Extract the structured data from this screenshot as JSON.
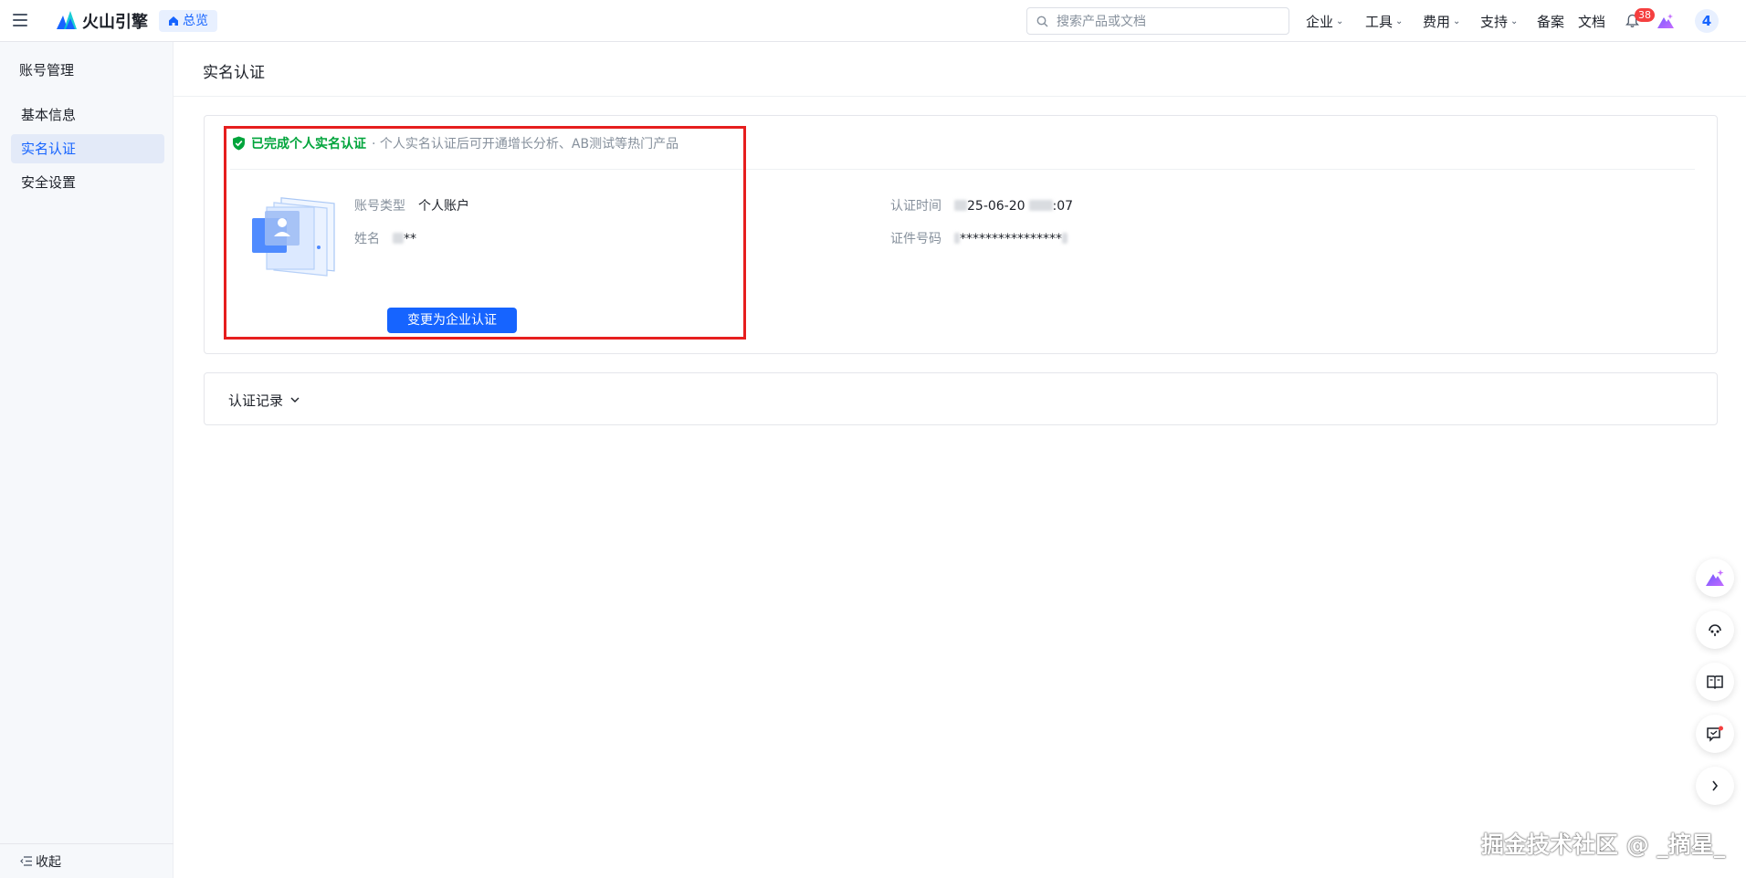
{
  "header": {
    "brand_name": "火山引擎",
    "home_chip": "总览",
    "search_placeholder": "搜索产品或文档",
    "nav": [
      {
        "label": "企业",
        "dropdown": true
      },
      {
        "label": "工具",
        "dropdown": true
      },
      {
        "label": "费用",
        "dropdown": true
      },
      {
        "label": "支持",
        "dropdown": true
      },
      {
        "label": "备案",
        "dropdown": false
      },
      {
        "label": "文档",
        "dropdown": false
      }
    ],
    "notification_count": "38",
    "avatar_text": "4"
  },
  "sidebar": {
    "title": "账号管理",
    "items": [
      {
        "label": "基本信息",
        "active": false
      },
      {
        "label": "实名认证",
        "active": true
      },
      {
        "label": "安全设置",
        "active": false
      }
    ],
    "collapse_label": "收起"
  },
  "main": {
    "page_title": "实名认证",
    "status": {
      "main": "已完成个人实名认证",
      "sub": "· 个人实名认证后可开通增长分析、AB测试等热门产品"
    },
    "account_type_label": "账号类型",
    "account_type_value": "个人账户",
    "name_label": "姓名",
    "name_value": "**",
    "auth_time_label": "认证时间",
    "auth_time_value_part1": "25-06-20",
    "auth_time_value_part2": ":07",
    "id_number_label": "证件号码",
    "id_number_value": "****************",
    "change_button": "变更为企业认证",
    "records_label": "认证记录"
  },
  "watermark": "掘金技术社区 @ _摘星_",
  "colors": {
    "primary": "#1664ff",
    "success": "#00a43b",
    "highlight_border": "#e61e1e",
    "badge": "#f53f3f"
  }
}
